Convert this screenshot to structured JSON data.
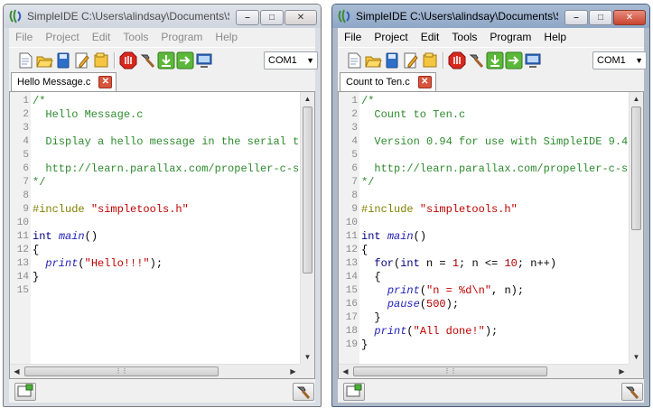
{
  "windows": [
    {
      "title": "SimpleIDE C:\\Users\\alindsay\\Documents\\Sim...",
      "menu": [
        "File",
        "Project",
        "Edit",
        "Tools",
        "Program",
        "Help"
      ],
      "port": "COM1",
      "tab": "Hello Message.c",
      "line_numbers": [
        "1",
        "2",
        "3",
        "4",
        "5",
        "6",
        "7",
        "8",
        "9",
        "10",
        "11",
        "12",
        "13",
        "14",
        "15"
      ],
      "code": {
        "l1": "/*",
        "l2": "  Hello Message.c",
        "l4": "  Display a hello message in the serial t",
        "l6": "  http://learn.parallax.com/propeller-c-s",
        "l7": "*/",
        "l9_pp": "#include",
        "l9_str": "\"simpletools.h\"",
        "l11_kw": "int",
        "l11_fn": "main",
        "l11_rest": "()",
        "l12": "{",
        "l13_fn": "print",
        "l13_str": "\"Hello!!!\"",
        "l13_end": ");",
        "l14": "}"
      }
    },
    {
      "title": "SimpleIDE C:\\Users\\alindsay\\Documents\\Sim...",
      "menu": [
        "File",
        "Project",
        "Edit",
        "Tools",
        "Program",
        "Help"
      ],
      "port": "COM1",
      "tab": "Count to Ten.c",
      "line_numbers": [
        "1",
        "2",
        "3",
        "4",
        "5",
        "6",
        "7",
        "8",
        "9",
        "10",
        "11",
        "12",
        "13",
        "14",
        "15",
        "16",
        "17",
        "18",
        "19"
      ],
      "code": {
        "l1": "/*",
        "l2": "  Count to Ten.c",
        "l4": "  Version 0.94 for use with SimpleIDE 9.4",
        "l6": "  http://learn.parallax.com/propeller-c-s",
        "l7": "*/",
        "l9_pp": "#include",
        "l9_str": "\"simpletools.h\"",
        "l11_kw": "int",
        "l11_fn": "main",
        "l11_rest": "()",
        "l12": "{",
        "l13_kw1": "for",
        "l13_a": "(",
        "l13_kw2": "int",
        "l13_b": " n = ",
        "l13_n1": "1",
        "l13_c": "; n <= ",
        "l13_n2": "10",
        "l13_d": "; n++)",
        "l14": "  {",
        "l15_fn": "print",
        "l15_str": "\"n = %d\\n\"",
        "l15_end": ", n);",
        "l16_fn": "pause",
        "l16_n": "500",
        "l16_end": ");",
        "l17": "  }",
        "l18_fn": "print",
        "l18_str": "\"All done!\"",
        "l18_end": ");",
        "l19": "}"
      }
    }
  ],
  "icons": {
    "app": "simpleide-logo-icon",
    "toolbar": [
      "new-project-icon",
      "open-project-icon",
      "save-project-icon",
      "project-options-icon",
      "open-folder-icon",
      "stop-icon",
      "build-hammer-icon",
      "load-ram-icon",
      "load-eeprom-icon",
      "run-with-terminal-icon"
    ],
    "status_left": "project-view-icon",
    "status_right": "build-status-icon"
  },
  "colors": {
    "comment": "#2e8b2e",
    "preprocessor": "#808000",
    "string": "#c00000",
    "keyword": "#000080",
    "function": "#2222bb",
    "tab_close": "#d8543c"
  }
}
